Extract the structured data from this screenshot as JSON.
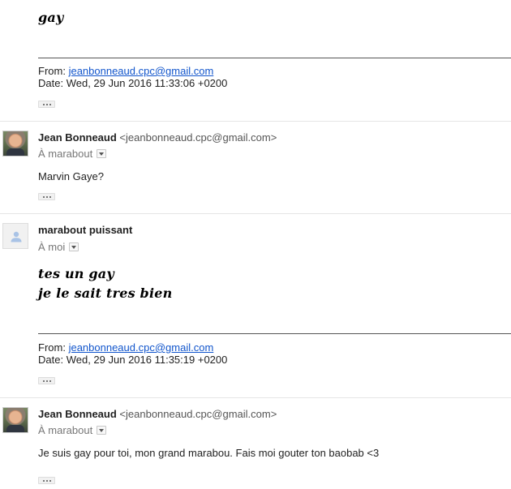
{
  "top_message": {
    "body": "gay",
    "quote": {
      "from_label": "From:",
      "from_email": "jeanbonneaud.cpc@gmail.com",
      "date_label": "Date:",
      "date_value": "Wed, 29 Jun 2016 11:33:06 +0200"
    }
  },
  "messages": [
    {
      "sender_name": "Jean Bonneaud",
      "sender_email": "<jeanbonneaud.cpc@gmail.com>",
      "recipient": "À marabout",
      "body": "Marvin Gaye?"
    },
    {
      "sender_name": "marabout puissant",
      "sender_email": "",
      "recipient": "À moi",
      "body_line1": "tes un gay",
      "body_line2": "je le sait tres bien",
      "quote": {
        "from_label": "From:",
        "from_email": "jeanbonneaud.cpc@gmail.com",
        "date_label": "Date:",
        "date_value": "Wed, 29 Jun 2016 11:35:19 +0200"
      }
    },
    {
      "sender_name": "Jean Bonneaud",
      "sender_email": "<jeanbonneaud.cpc@gmail.com>",
      "recipient": "À marabout",
      "body": "Je suis gay pour toi, mon grand marabou. Fais moi gouter ton baobab <3"
    }
  ],
  "icons": {
    "show_trimmed": "ellipsis-icon",
    "recipient_dropdown": "chevron-down-icon",
    "default_avatar": "person-icon"
  },
  "colors": {
    "link": "#1155cc",
    "separator": "#e5e5e5",
    "muted": "#777777"
  }
}
